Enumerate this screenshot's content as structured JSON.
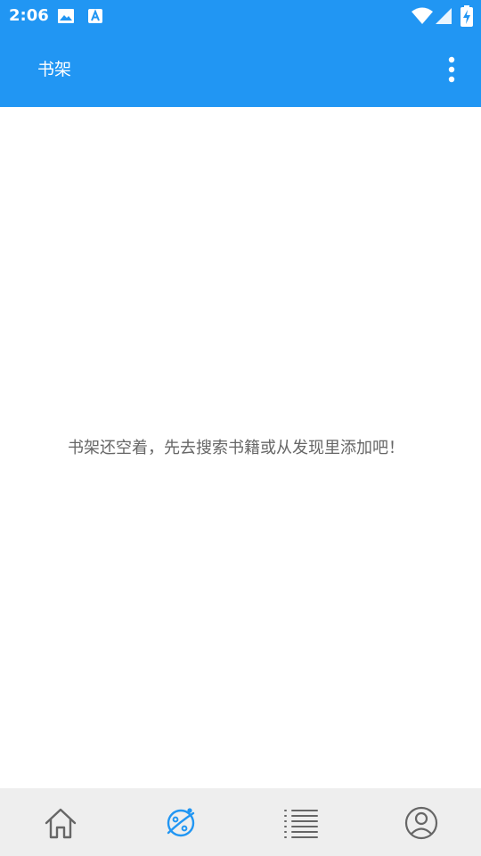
{
  "status_bar": {
    "time": "2:06",
    "notification_icons": [
      "image-icon",
      "text-a-icon"
    ],
    "system_icons": [
      "wifi-icon",
      "cellular-icon",
      "battery-charging-icon"
    ]
  },
  "app_bar": {
    "title": "书架",
    "overflow_icon": "more-vert-icon",
    "color": "#2196f3"
  },
  "main": {
    "empty_message": "书架还空着，先去搜索书籍或从发现里添加吧！"
  },
  "bottom_nav": {
    "items": [
      {
        "icon": "home-icon",
        "selected": false
      },
      {
        "icon": "discover-icon",
        "selected": true
      },
      {
        "icon": "list-icon",
        "selected": false
      },
      {
        "icon": "profile-icon",
        "selected": false
      }
    ],
    "selected_color": "#2196f3",
    "unselected_color": "#666666"
  }
}
